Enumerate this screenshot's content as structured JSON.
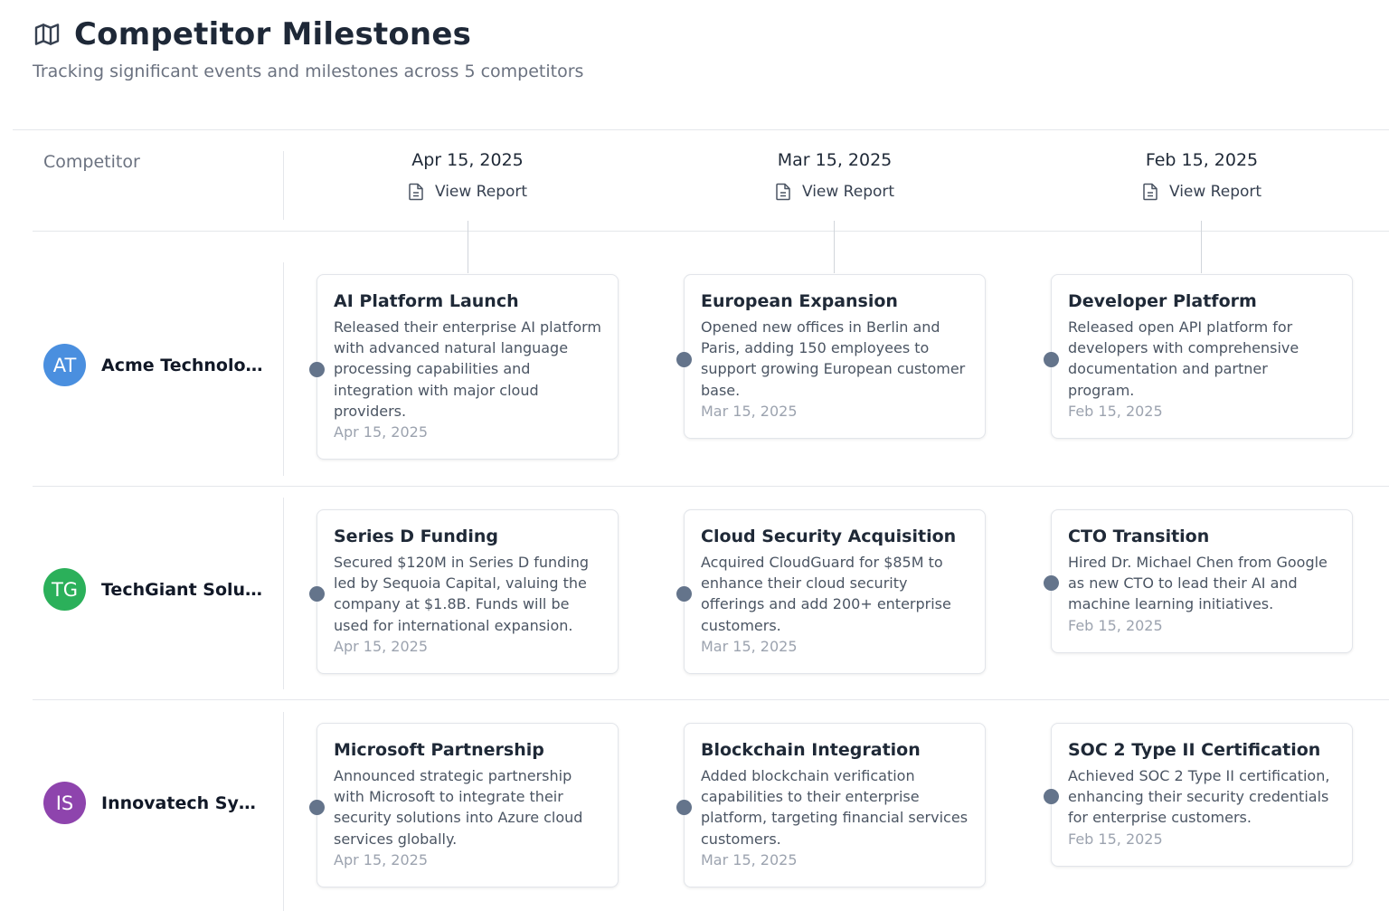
{
  "header": {
    "title": "Competitor Milestones",
    "subtitle": "Tracking significant events and milestones across 5 competitors",
    "icon": "map-icon"
  },
  "table": {
    "competitor_label": "Competitor",
    "columns": [
      {
        "date": "Apr 15, 2025",
        "report_label": "View Report"
      },
      {
        "date": "Mar 15, 2025",
        "report_label": "View Report"
      },
      {
        "date": "Feb 15, 2025",
        "report_label": "View Report"
      }
    ],
    "rows": [
      {
        "initials": "AT",
        "name": "Acme Technologies",
        "avatar_color": "#4a8fdf",
        "milestones": [
          {
            "title": "AI Platform Launch",
            "description": "Released their enterprise AI platform with advanced natural language processing capabilities and integration with major cloud providers.",
            "date": "Apr 15, 2025"
          },
          {
            "title": "European Expansion",
            "description": "Opened new offices in Berlin and Paris, adding 150 employees to support growing European customer base.",
            "date": "Mar 15, 2025"
          },
          {
            "title": "Developer Platform",
            "description": "Released open API platform for developers with comprehensive documentation and partner program.",
            "date": "Feb 15, 2025"
          }
        ]
      },
      {
        "initials": "TG",
        "name": "TechGiant Solutions",
        "avatar_color": "#2bb05a",
        "milestones": [
          {
            "title": "Series D Funding",
            "description": "Secured $120M in Series D funding led by Sequoia Capital, valuing the company at $1.8B. Funds will be used for international expansion.",
            "date": "Apr 15, 2025"
          },
          {
            "title": "Cloud Security Acquisition",
            "description": "Acquired CloudGuard for $85M to enhance their cloud security offerings and add 200+ enterprise customers.",
            "date": "Mar 15, 2025"
          },
          {
            "title": "CTO Transition",
            "description": "Hired Dr. Michael Chen from Google as new CTO to lead their AI and machine learning initiatives.",
            "date": "Feb 15, 2025"
          }
        ]
      },
      {
        "initials": "IS",
        "name": "Innovatech Systems",
        "avatar_color": "#8e44ad",
        "milestones": [
          {
            "title": "Microsoft Partnership",
            "description": "Announced strategic partnership with Microsoft to integrate their security solutions into Azure cloud services globally.",
            "date": "Apr 15, 2025"
          },
          {
            "title": "Blockchain Integration",
            "description": "Added blockchain verification capabilities to their enterprise platform, targeting financial services customers.",
            "date": "Mar 15, 2025"
          },
          {
            "title": "SOC 2 Type II Certification",
            "description": "Achieved SOC 2 Type II certification, enhancing their security credentials for enterprise customers.",
            "date": "Feb 15, 2025"
          }
        ]
      }
    ]
  }
}
